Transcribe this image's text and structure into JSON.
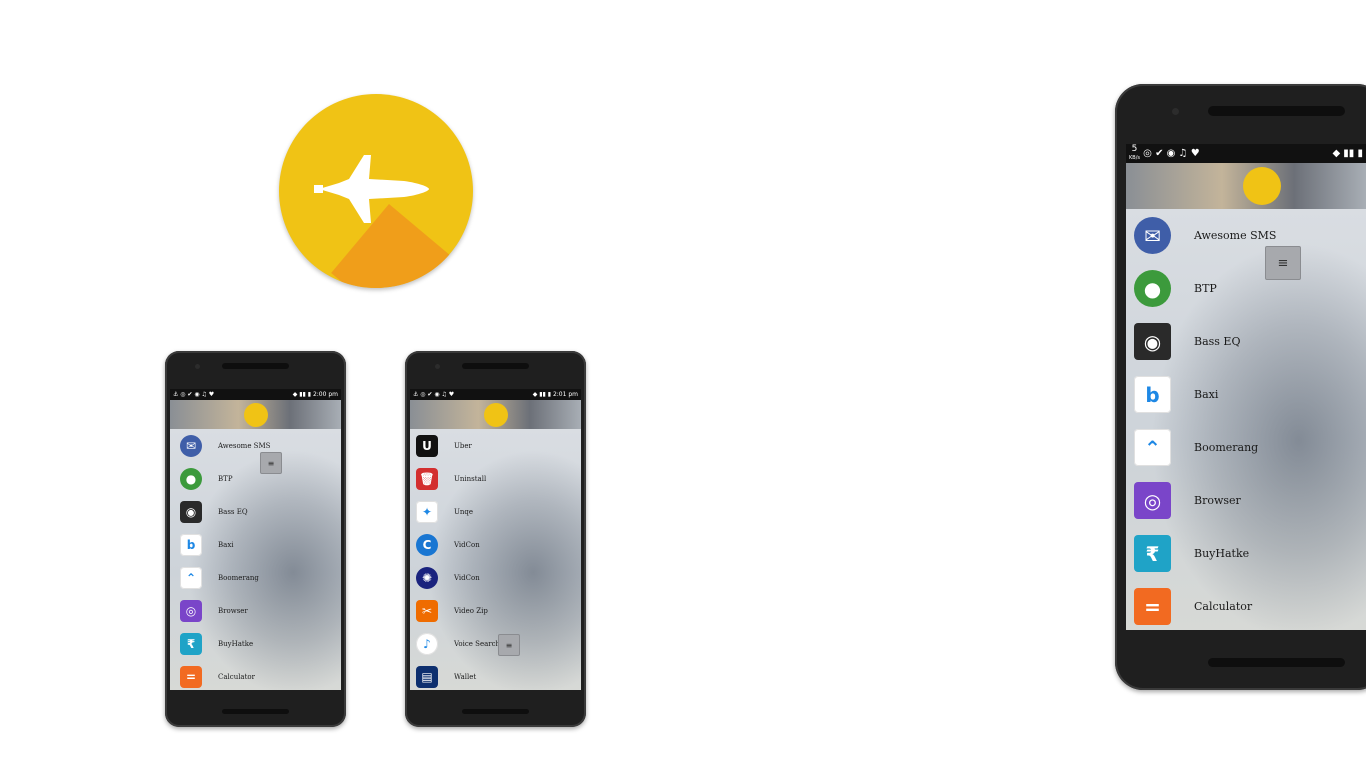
{
  "logo": {
    "name": "shuttle-launcher-logo",
    "color": "#f0c315"
  },
  "phones": [
    {
      "time": "2:00 pm",
      "items": [
        {
          "label": "Awesome SMS",
          "icon": "envelope-icon",
          "color": "#3f5ea8"
        },
        {
          "label": "BTP",
          "icon": "btp-icon",
          "color": "#3c9a3c"
        },
        {
          "label": "Bass EQ",
          "icon": "knob-icon",
          "color": "#2a2a2a"
        },
        {
          "label": "Baxi",
          "icon": "baxi-b-icon",
          "color": "#ffffff"
        },
        {
          "label": "Boomerang",
          "icon": "boomerang-icon",
          "color": "#ffffff"
        },
        {
          "label": "Browser",
          "icon": "browser-icon",
          "color": "#7a45c9"
        },
        {
          "label": "BuyHatke",
          "icon": "rupee-icon",
          "color": "#1fa3c7"
        },
        {
          "label": "Calculator",
          "icon": "equals-icon",
          "color": "#f26a21"
        }
      ]
    },
    {
      "time": "2:01 pm",
      "items": [
        {
          "label": "Uber",
          "icon": "uber-icon",
          "color": "#111111"
        },
        {
          "label": "Uninstall",
          "icon": "trash-icon",
          "color": "#d32f2f"
        },
        {
          "label": "Unqe",
          "icon": "unqe-icon",
          "color": "#ffffff"
        },
        {
          "label": "VidCon",
          "icon": "vidcon-icon",
          "color": "#1976d2"
        },
        {
          "label": "VidCon",
          "icon": "film-reel-icon",
          "color": "#1a237e"
        },
        {
          "label": "Video Zip",
          "icon": "scissors-icon",
          "color": "#ef6c00"
        },
        {
          "label": "Voice Search",
          "icon": "mic-icon",
          "color": "#ffffff"
        },
        {
          "label": "Wallet",
          "icon": "paytm-wallet-icon",
          "color": "#0d2f6e"
        }
      ]
    },
    {
      "net_speed_value": "5",
      "net_speed_unit": "KB/s",
      "items": [
        {
          "label": "Awesome SMS",
          "icon": "envelope-icon",
          "color": "#3f5ea8"
        },
        {
          "label": "BTP",
          "icon": "btp-icon",
          "color": "#3c9a3c"
        },
        {
          "label": "Bass EQ",
          "icon": "knob-icon",
          "color": "#2a2a2a"
        },
        {
          "label": "Baxi",
          "icon": "baxi-b-icon",
          "color": "#ffffff"
        },
        {
          "label": "Boomerang",
          "icon": "boomerang-icon",
          "color": "#ffffff"
        },
        {
          "label": "Browser",
          "icon": "browser-icon",
          "color": "#7a45c9"
        },
        {
          "label": "BuyHatke",
          "icon": "rupee-icon",
          "color": "#1fa3c7"
        },
        {
          "label": "Calculator",
          "icon": "equals-icon",
          "color": "#f26a21"
        }
      ]
    }
  ]
}
